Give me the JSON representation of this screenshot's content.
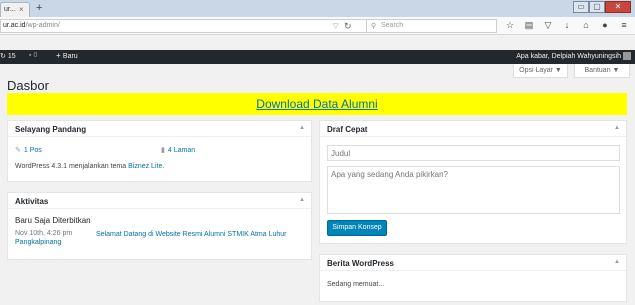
{
  "browser": {
    "tab_title": "ur...",
    "tab_close": "×",
    "new_tab": "+",
    "url_host": "ur.ac.id",
    "url_path": "/wp-admin/",
    "search_placeholder": "Search",
    "window_buttons": [
      "▭",
      "▢",
      "✕"
    ]
  },
  "adminbar": {
    "updates": "15",
    "comments": "0",
    "new_label": "Baru",
    "howdy": "Apa kabar, Delpiah Wahyuningsih"
  },
  "screen_options": [
    "Opsi Layar ▼",
    "Bantuan ▼"
  ],
  "page_title": "Dasbor",
  "banner_link": "Download Data Alumni",
  "at_a_glance": {
    "title": "Selayang Pandang",
    "posts": "1 Pos",
    "pages": "4 Laman",
    "theme_prefix": "WordPress 4.3.1 menjalankan tema ",
    "theme_link": "Biznez Lite",
    "theme_suffix": "."
  },
  "activity": {
    "title": "Aktivitas",
    "heading": "Baru Saja Diterbitkan",
    "date": "Nov 10th, 4:26 pm",
    "post_title": "Selamat Datang di Website Resmi Alumni STMIK Atma Luhur",
    "post_title_tail": "Pangkalpinang"
  },
  "quick_draft": {
    "title": "Draf Cepat",
    "title_placeholder": "Judul",
    "content_placeholder": "Apa yang sedang Anda pikirkan?",
    "save_label": "Simpan Konsep"
  },
  "wp_news": {
    "title": "Berita WordPress",
    "loading": "Sedang memuat..."
  }
}
